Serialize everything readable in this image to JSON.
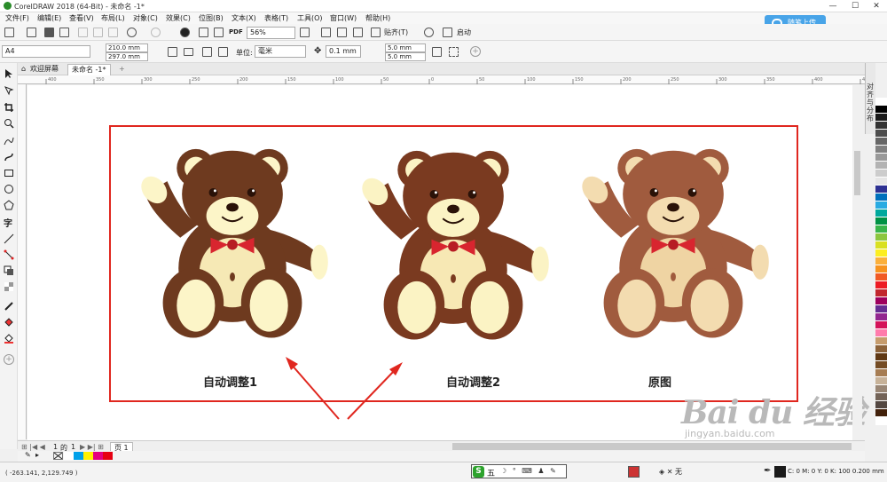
{
  "window": {
    "title": "CorelDRAW 2018 (64-Bit) - 未命名 -1*",
    "controls": [
      "—",
      "☐",
      "✕"
    ]
  },
  "menu": [
    "文件(F)",
    "编辑(E)",
    "查看(V)",
    "布局(L)",
    "对象(C)",
    "效果(C)",
    "位图(B)",
    "文本(X)",
    "表格(T)",
    "工具(O)",
    "窗口(W)",
    "帮助(H)"
  ],
  "cloud_button": "随笔上传",
  "toolbar": {
    "zoom": "56%",
    "snap_label": "贴齐(T)",
    "launch_label": "启动",
    "pdf_label": "PDF"
  },
  "property_bar": {
    "page_size": "A4",
    "width": "210.0 mm",
    "height": "297.0 mm",
    "units_label": "单位:",
    "units": "毫米",
    "nudge": "0.1 mm",
    "dup_x": "5.0 mm",
    "dup_y": "5.0 mm"
  },
  "tabs": {
    "welcome": "欢迎屏幕",
    "document": "未命名 -1*",
    "add": "+"
  },
  "ruler_ticks": [
    "400",
    "350",
    "300",
    "250",
    "200",
    "150",
    "100",
    "50",
    "0",
    "50",
    "100",
    "150",
    "200",
    "250",
    "300",
    "350",
    "400",
    "450",
    "500"
  ],
  "dock_panel": "对齐与分布",
  "captions": [
    "自动调整1",
    "自动调整2",
    "原图"
  ],
  "page_nav": {
    "current": "1",
    "of": "的",
    "total": "1",
    "page_tab": "页 1"
  },
  "status": {
    "coords": "( -263.141, 2,129.749 )",
    "ime_label": "五",
    "ime_icons": "☽ ° ⌨ ♟ ✎",
    "fill": "无",
    "color": "C: 0 M: 0 Y: 0 K: 100  0.200 mm"
  },
  "watermark": {
    "brand": "Bai du 经验",
    "url": "jingyan.baidu.com"
  },
  "palette_colors": [
    "#ffffff",
    "#000000",
    "#1a1a1a",
    "#333333",
    "#4d4d4d",
    "#666666",
    "#808080",
    "#999999",
    "#b3b3b3",
    "#cccccc",
    "#e6e6e6",
    "#2e3192",
    "#0071bc",
    "#29abe2",
    "#00a99d",
    "#009245",
    "#39b54a",
    "#8cc63f",
    "#d9e021",
    "#fcee21",
    "#fbb03b",
    "#f7931e",
    "#f15a24",
    "#ed1c24",
    "#c1272d",
    "#9e005d",
    "#662d91",
    "#93278f",
    "#d4145a",
    "#ff7bac",
    "#c69c6d",
    "#8c6239",
    "#603813",
    "#754c24",
    "#a67c52",
    "#c7b299",
    "#998675",
    "#736357",
    "#534741",
    "#42210b",
    "#ffffff"
  ],
  "doc_colors": [
    "#ffffff",
    "#00a0e9",
    "#fff100",
    "#e4007f",
    "#e60012"
  ],
  "bears": [
    {
      "fur": "#6e3a1f",
      "light": "#fcf5c8",
      "inner": "#f6e9b5"
    },
    {
      "fur": "#7a3a20",
      "light": "#fbf3c4",
      "inner": "#f7e8b4"
    },
    {
      "fur": "#a05b3e",
      "light": "#f3dcb0",
      "inner": "#efd4a3"
    }
  ]
}
